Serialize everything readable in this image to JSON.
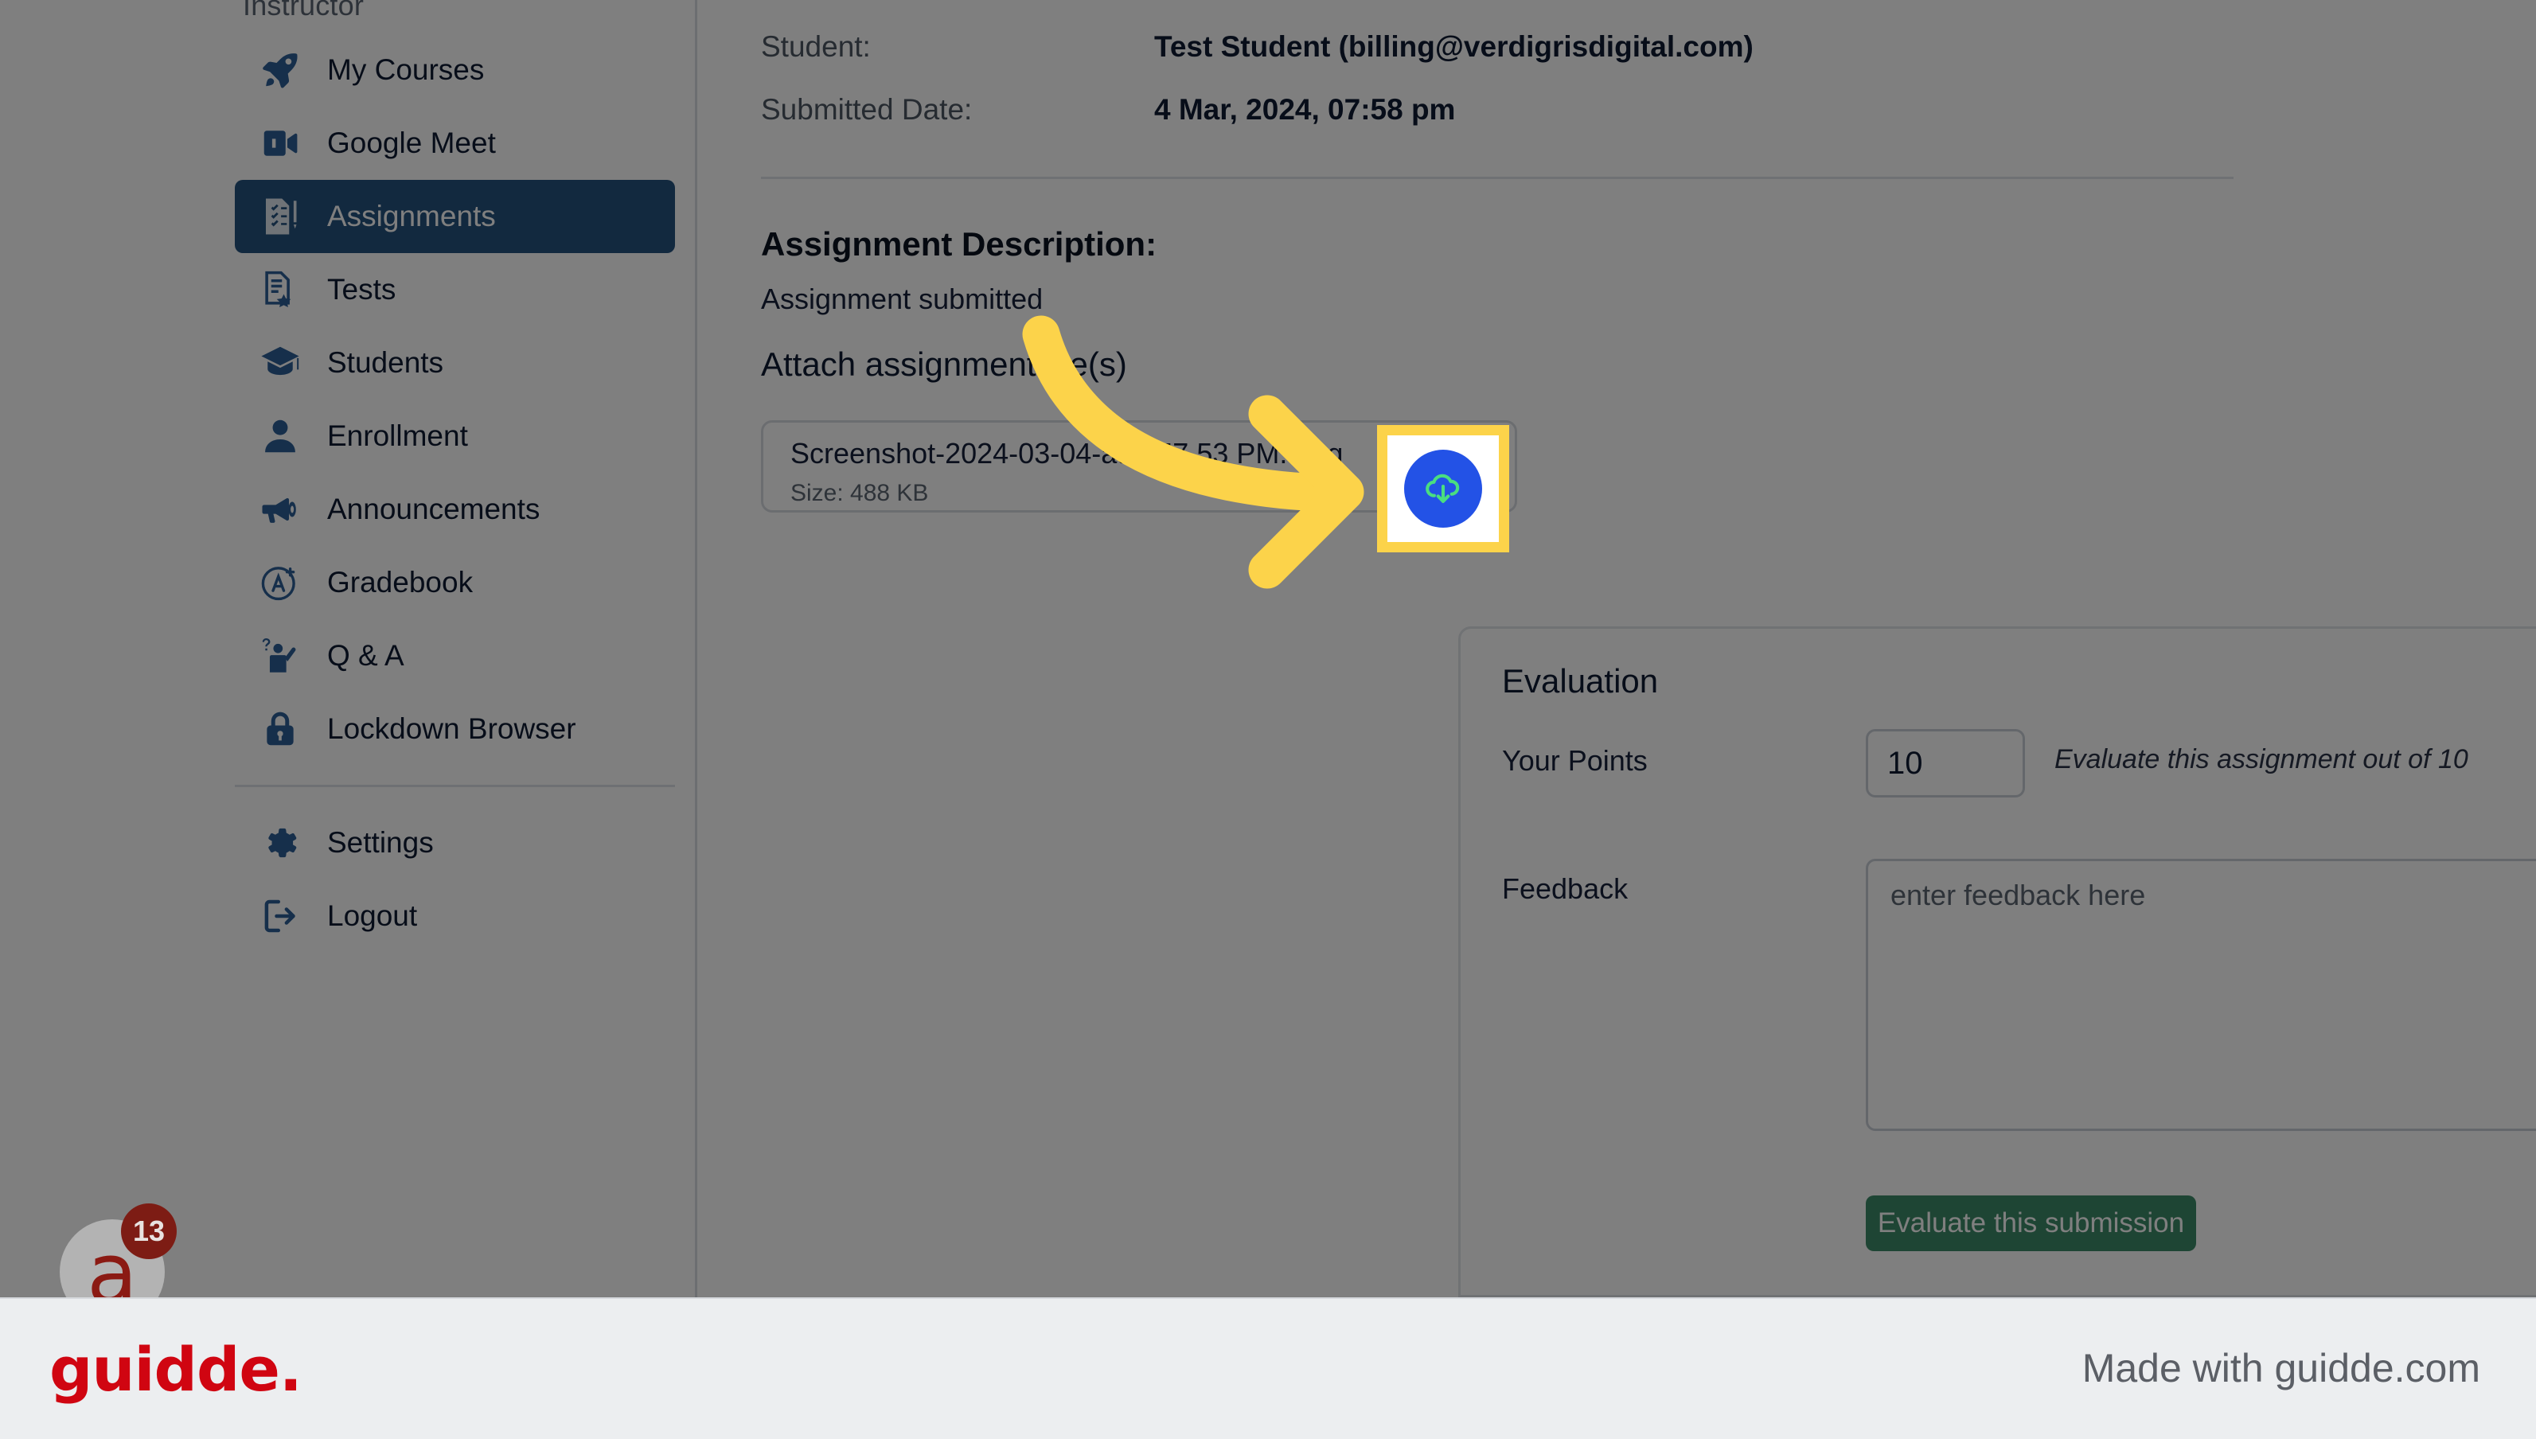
{
  "sidebar": {
    "section_label": "Instructor",
    "items": [
      {
        "label": "My Courses",
        "icon": "rocket-icon",
        "active": false
      },
      {
        "label": "Google Meet",
        "icon": "video-camera-icon",
        "active": false
      },
      {
        "label": "Assignments",
        "icon": "checklist-icon",
        "active": true
      },
      {
        "label": "Tests",
        "icon": "document-star-icon",
        "active": false
      },
      {
        "label": "Students",
        "icon": "graduation-cap-icon",
        "active": false
      },
      {
        "label": "Enrollment",
        "icon": "person-icon",
        "active": false
      },
      {
        "label": "Announcements",
        "icon": "megaphone-icon",
        "active": false
      },
      {
        "label": "Gradebook",
        "icon": "grade-a-plus-icon",
        "active": false
      },
      {
        "label": "Q & A",
        "icon": "raised-hand-question-icon",
        "active": false
      },
      {
        "label": "Lockdown Browser",
        "icon": "lock-icon",
        "active": false
      }
    ],
    "footer_items": [
      {
        "label": "Settings",
        "icon": "gear-icon",
        "active": false
      },
      {
        "label": "Logout",
        "icon": "logout-icon",
        "active": false
      }
    ]
  },
  "avatar": {
    "initial": "a",
    "badge_count": "13"
  },
  "submission": {
    "student_label": "Student:",
    "student_value": "Test Student (billing@verdigrisdigital.com)",
    "submitted_label": "Submitted Date:",
    "submitted_value": "4 Mar, 2024, 07:58 pm",
    "description_heading": "Assignment Description:",
    "description_text": "Assignment submitted",
    "attach_heading": "Attach assignment file(s)",
    "file": {
      "name": "Screenshot-2024-03-04-at 7.57.53 PM..png",
      "size": "Size: 488 KB",
      "download_icon": "cloud-download-icon"
    }
  },
  "evaluation": {
    "title": "Evaluation",
    "points_label": "Your Points",
    "points_value": "10",
    "points_hint": "Evaluate this assignment out of 10",
    "feedback_label": "Feedback",
    "feedback_value": "",
    "feedback_placeholder": "enter feedback here",
    "submit_label": "Evaluate this submission"
  },
  "footer": {
    "logo": "guidde.",
    "credit": "Made with guidde.com"
  },
  "colors": {
    "accent_blue": "#2c5f96",
    "active_nav": "#25527f",
    "download_blue": "#2352e6",
    "download_icon_green": "#4ade80",
    "highlight_yellow": "#fcd34a",
    "submit_green": "#3d8b69",
    "brand_red": "#d00511"
  }
}
